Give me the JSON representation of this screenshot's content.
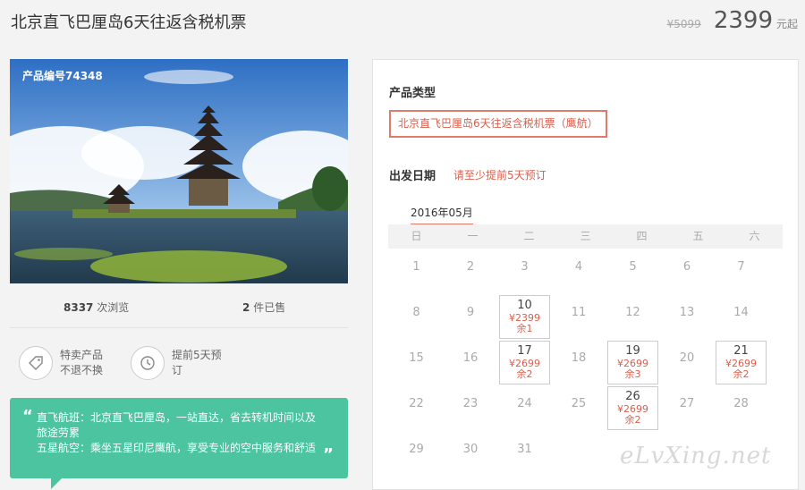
{
  "header": {
    "title": "北京直飞巴厘岛6天往返含税机票",
    "old_price": "¥5099",
    "price": "2399",
    "price_unit": "元起"
  },
  "product": {
    "number_label": "产品编号74348",
    "views_count": "8337",
    "views_label": "次浏览",
    "sold_count": "2",
    "sold_label": "件已售",
    "features": [
      {
        "icon": "tag-icon",
        "line1": "特卖产品",
        "line2": "不退不换"
      },
      {
        "icon": "clock-icon",
        "line1": "提前5天预",
        "line2": "订"
      }
    ],
    "highlight": {
      "line1": "直飞航班：北京直飞巴厘岛，一站直达，省去转机时间以及",
      "line2": "旅途劳累",
      "line3": "五星航空：乘坐五星印尼鹰航，享受专业的空中服务和舒适",
      "open_quote": "“",
      "close_quote": "”"
    }
  },
  "booking": {
    "type_label": "产品类型",
    "type_option": "北京直飞巴厘岛6天往返含税机票（鹰航）",
    "date_label": "出发日期",
    "date_hint": "请至少提前5天预订",
    "month": "2016年05月",
    "weekdays": [
      "日",
      "一",
      "二",
      "三",
      "四",
      "五",
      "六"
    ],
    "weeks": [
      [
        {
          "d": "1"
        },
        {
          "d": "2"
        },
        {
          "d": "3"
        },
        {
          "d": "4"
        },
        {
          "d": "5"
        },
        {
          "d": "6"
        },
        {
          "d": "7"
        }
      ],
      [
        {
          "d": "8"
        },
        {
          "d": "9"
        },
        {
          "d": "10",
          "p": "¥2399",
          "r": "余1"
        },
        {
          "d": "11"
        },
        {
          "d": "12"
        },
        {
          "d": "13"
        },
        {
          "d": "14"
        }
      ],
      [
        {
          "d": "15"
        },
        {
          "d": "16"
        },
        {
          "d": "17",
          "p": "¥2699",
          "r": "余2"
        },
        {
          "d": "18"
        },
        {
          "d": "19",
          "p": "¥2699",
          "r": "余3"
        },
        {
          "d": "20"
        },
        {
          "d": "21",
          "p": "¥2699",
          "r": "余2"
        }
      ],
      [
        {
          "d": "22"
        },
        {
          "d": "23"
        },
        {
          "d": "24"
        },
        {
          "d": "25"
        },
        {
          "d": "26",
          "p": "¥2699",
          "r": "余2"
        },
        {
          "d": "27"
        },
        {
          "d": "28"
        }
      ],
      [
        {
          "d": "29"
        },
        {
          "d": "30"
        },
        {
          "d": "31"
        }
      ]
    ]
  },
  "watermark": "eLvXing.net",
  "colors": {
    "accent": "#d9604e",
    "green": "#4cc4a0"
  }
}
